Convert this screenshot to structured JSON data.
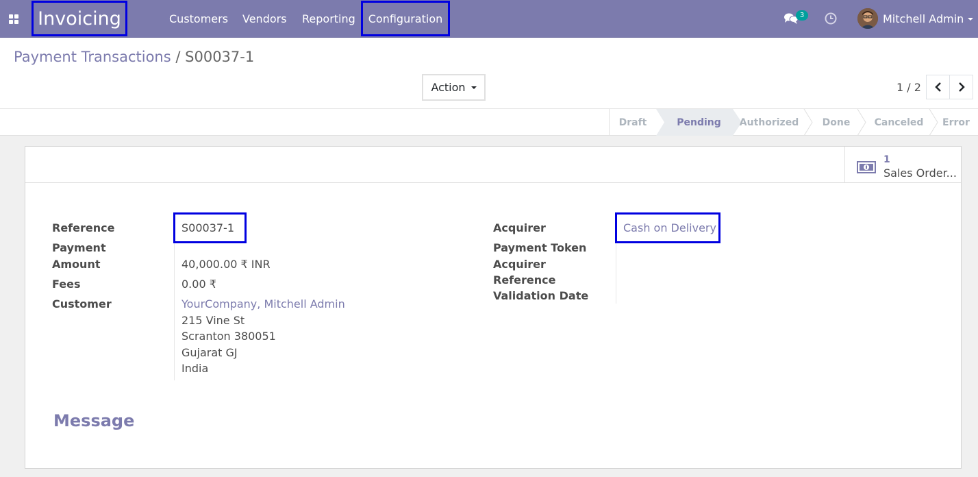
{
  "navbar": {
    "app_name": "Invoicing",
    "menu": [
      "Customers",
      "Vendors",
      "Reporting",
      "Configuration"
    ],
    "chat_count": "3",
    "user_name": "Mitchell Admin"
  },
  "breadcrumb": {
    "parent": "Payment Transactions",
    "separator": "/",
    "current": "S00037-1"
  },
  "toolbar": {
    "action_label": "Action",
    "pager": "1 / 2"
  },
  "statusbar": {
    "stages": [
      "Draft",
      "Pending",
      "Authorized",
      "Done",
      "Canceled",
      "Error"
    ],
    "active": "Pending"
  },
  "smart_button": {
    "value": "1",
    "label": "Sales Order..."
  },
  "form": {
    "left": {
      "reference_label": "Reference",
      "reference_value": "S00037-1",
      "payment_amount_label_1": "Payment",
      "payment_amount_label_2": "Amount",
      "payment_amount_value": "40,000.00 ₹ INR",
      "fees_label": "Fees",
      "fees_value": "0.00 ₹",
      "customer_label": "Customer",
      "customer_name": "YourCompany, Mitchell Admin",
      "customer_address": [
        "215 Vine St",
        "Scranton 380051",
        "Gujarat GJ",
        "India"
      ]
    },
    "right": {
      "acquirer_label": "Acquirer",
      "acquirer_value": "Cash on Delivery",
      "payment_token_label": "Payment Token",
      "acquirer_reference_label_1": "Acquirer",
      "acquirer_reference_label_2": "Reference",
      "validation_date_label": "Validation Date"
    },
    "message_title": "Message"
  },
  "colors": {
    "brand": "#7c7bad",
    "highlight": "#0000e0",
    "badge": "#00a09d"
  }
}
